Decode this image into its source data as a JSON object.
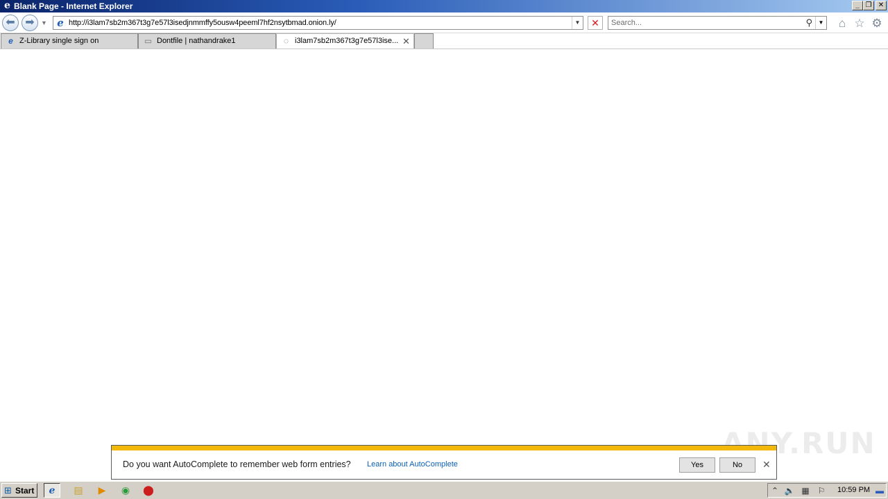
{
  "window": {
    "title": "Blank Page - Internet Explorer",
    "controls": {
      "minimize": "_",
      "restore": "❐",
      "close": "✕"
    }
  },
  "navbar": {
    "back_glyph": "⬅",
    "forward_glyph": "➡",
    "address": "http://i3lam7sb2m367t3g7e57l3isedjnmmffy5ousw4peeml7hf2nsytbmad.onion.ly/",
    "stop_glyph": "✕",
    "search_placeholder": "Search..."
  },
  "tabs": [
    {
      "label": "Z-Library single sign on",
      "icon": "ie-icon",
      "active": false
    },
    {
      "label": "Dontfile | nathandrake1",
      "icon": "page-icon",
      "active": false
    },
    {
      "label": "i3lam7sb2m367t3g7e57l3ise...",
      "icon": "loading-icon",
      "active": true
    }
  ],
  "notification": {
    "message": "Do you want AutoComplete to remember web form entries?",
    "link": "Learn about AutoComplete",
    "yes_label": "Yes",
    "no_label": "No",
    "accent_color": "#f2b80a"
  },
  "watermark": "ANY.RUN",
  "taskbar": {
    "start_label": "Start",
    "clock": "10:59 PM"
  }
}
